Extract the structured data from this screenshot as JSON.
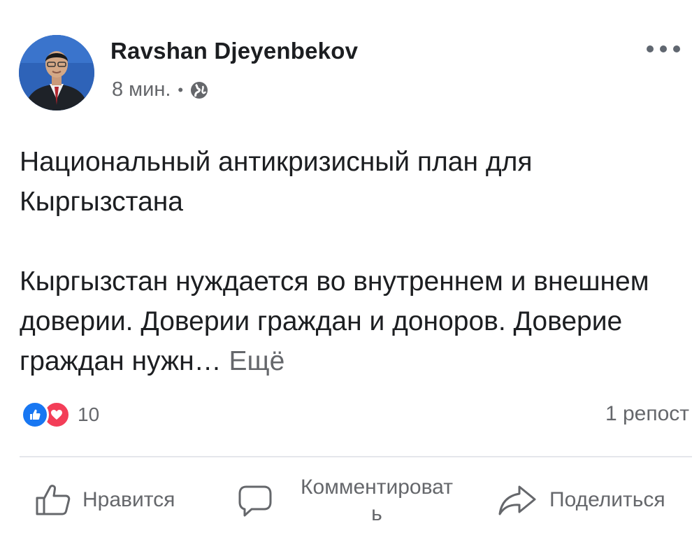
{
  "post": {
    "author": "Ravshan Djeyenbekov",
    "time": "8 мин.",
    "separator": "•",
    "paragraph1": "Национальный антикризисный план для Кыргызстана",
    "paragraph2": "Кыргызстан нуждается во внутреннем и внешнем доверии. Доверии граждан и доноров. Доверие граждан нужн…",
    "see_more": "Ещё"
  },
  "stats": {
    "reaction_count": "10",
    "reposts": "1 репост"
  },
  "actions": {
    "like": "Нравится",
    "comment": "Комментироват\nь",
    "share": "Поделиться"
  },
  "colors": {
    "like_blue": "#1877f2",
    "love_red": "#f33e58",
    "secondary_text": "#65676b"
  },
  "icons": [
    "globe-icon",
    "more-options-icon",
    "like-reaction-icon",
    "love-reaction-icon",
    "thumbs-up-icon",
    "comment-icon",
    "share-icon"
  ]
}
